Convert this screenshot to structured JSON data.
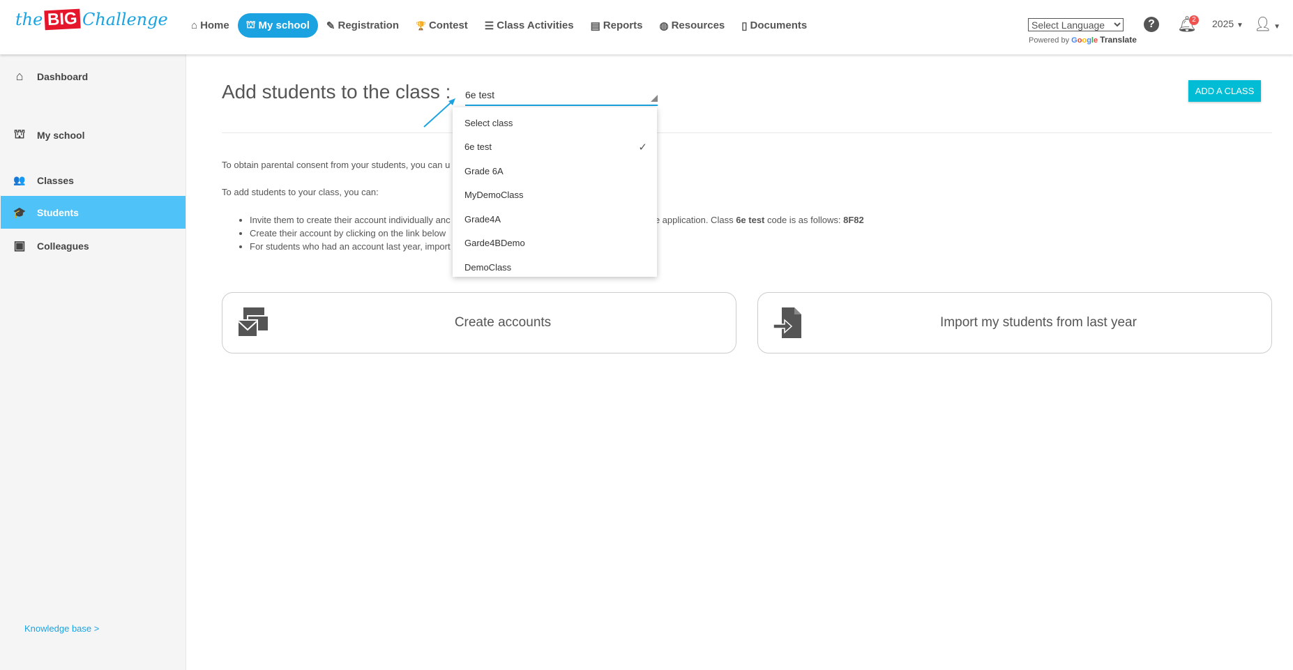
{
  "logo": {
    "text_pre": "the",
    "text_big": "BIG",
    "text_post": "Challenge"
  },
  "nav": [
    {
      "label": "Home",
      "icon": "home-icon",
      "glyph": "⌂"
    },
    {
      "label": "My school",
      "icon": "school-icon",
      "glyph": "⛫",
      "active": true
    },
    {
      "label": "Registration",
      "icon": "edit-icon",
      "glyph": "✎"
    },
    {
      "label": "Contest",
      "icon": "trophy-icon",
      "glyph": "🏆"
    },
    {
      "label": "Class Activities",
      "icon": "list-icon",
      "glyph": "☰"
    },
    {
      "label": "Reports",
      "icon": "file-icon",
      "glyph": "▤"
    },
    {
      "label": "Resources",
      "icon": "globe-icon",
      "glyph": "◍"
    },
    {
      "label": "Documents",
      "icon": "pdf-icon",
      "glyph": "▯"
    }
  ],
  "language": {
    "selected": "Select Language",
    "powered_by": "Powered by",
    "google": "Google",
    "translate": "Translate"
  },
  "notifications": {
    "count": "2"
  },
  "year": "2025",
  "sidebar": {
    "items": [
      {
        "label": "Dashboard",
        "icon": "home-icon",
        "glyph": "⌂"
      },
      {
        "label": "My school",
        "icon": "school-icon",
        "glyph": "⛫"
      },
      {
        "label": "Classes",
        "icon": "users-icon",
        "glyph": "👥"
      },
      {
        "label": "Students",
        "icon": "student-icon",
        "glyph": "🎓",
        "active": true
      },
      {
        "label": "Colleagues",
        "icon": "contacts-icon",
        "glyph": "▣"
      }
    ],
    "knowledge_base": "Knowledge base >"
  },
  "main": {
    "title": "Add students to the class :",
    "selected_class": "6e test",
    "add_class": "ADD A CLASS",
    "consent_text": "To obtain parental consent from your students, you can u",
    "intro": "To add students to your class, you can:",
    "bullets": [
      {
        "a": "Invite them to create their account individually anc",
        "b": "he application. Class ",
        "cls": "6e test",
        "c": " code is as follows: ",
        "code": "8F82"
      },
      {
        "a": "Create their account by clicking on the link below"
      },
      {
        "a": "For students who had an account last year, import"
      }
    ],
    "dropdown": [
      "Select class",
      "6e test",
      "Grade 6A",
      "MyDemoClass",
      "Grade4A",
      "Garde4BDemo",
      "DemoClass"
    ],
    "cards": {
      "create": "Create accounts",
      "import": "Import my students from last year"
    }
  },
  "colors": {
    "accent": "#1aa3e0",
    "sidebar_active": "#4fc3f7",
    "button": "#00bcd4",
    "badge": "#ef5350"
  }
}
